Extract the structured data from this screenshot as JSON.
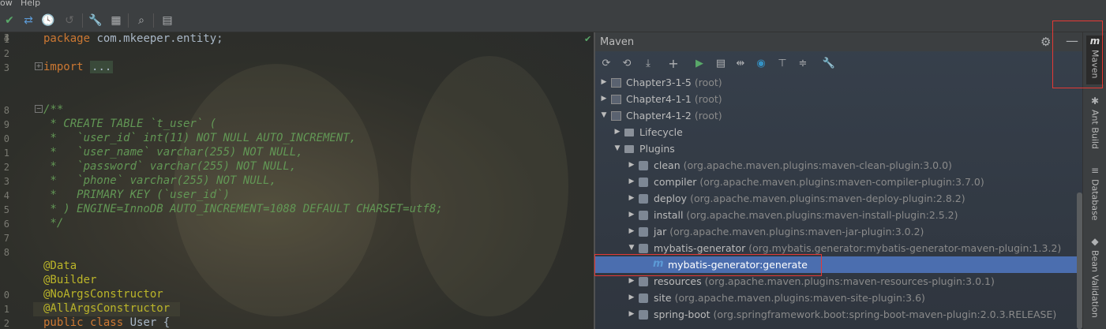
{
  "menu": {
    "items": [
      "ow",
      "Help"
    ]
  },
  "toolbar": {
    "icons": [
      "check-icon",
      "merge-icon",
      "history-icon",
      "undo-icon",
      "wrench-icon",
      "project-structure-icon",
      "search-icon",
      "terminal-icon"
    ]
  },
  "editor": {
    "line_numbers": [
      "1",
      "2",
      "3",
      "",
      "",
      "8",
      "9",
      "0",
      "1",
      "2",
      "3",
      "4",
      "5",
      "6",
      "7",
      "8",
      "",
      "",
      "0",
      "1",
      "2",
      "3",
      "4"
    ],
    "lines": [
      {
        "kind": "pkg",
        "kw": "package",
        "text": " com.mkeeper.entity;"
      },
      {
        "kind": "import",
        "kw": "import",
        "fold": "..."
      },
      {
        "kind": "comment",
        "text": "/**"
      },
      {
        "kind": "comment",
        "text": " * CREATE TABLE `t_user` ("
      },
      {
        "kind": "comment",
        "text": " *   `user_id` int(11) NOT NULL AUTO_INCREMENT,"
      },
      {
        "kind": "comment",
        "text": " *   `user_name` varchar(255) NOT NULL,"
      },
      {
        "kind": "comment",
        "text": " *   `password` varchar(255) NOT NULL,"
      },
      {
        "kind": "comment",
        "text": " *   `phone` varchar(255) NOT NULL,"
      },
      {
        "kind": "comment",
        "text": " *   PRIMARY KEY (`user_id`)"
      },
      {
        "kind": "comment",
        "text": " * ) ENGINE=InnoDB AUTO_INCREMENT=1088 DEFAULT CHARSET=utf8;"
      },
      {
        "kind": "comment",
        "text": " */"
      },
      {
        "kind": "anno",
        "text": "@Data"
      },
      {
        "kind": "anno",
        "text": "@Builder"
      },
      {
        "kind": "anno",
        "text": "@NoArgsConstructor"
      },
      {
        "kind": "anno",
        "text": "@AllArgsConstructor"
      },
      {
        "kind": "class",
        "kw": "public class",
        "text": " User {"
      }
    ]
  },
  "maven": {
    "title": "Maven",
    "tools": [
      "refresh-icon",
      "reimport-icon",
      "download-icon",
      "add-icon",
      "run-icon",
      "run-config-icon",
      "toggle-offline-icon",
      "skip-tests-icon",
      "show-deps-icon",
      "collapse-icon",
      "settings-wrench-icon"
    ],
    "tree": [
      {
        "depth": 0,
        "arrow": "▶",
        "icon": "module",
        "name": "Chapter3-1-5",
        "suffix": "(root)"
      },
      {
        "depth": 0,
        "arrow": "▶",
        "icon": "module",
        "name": "Chapter4-1-1",
        "suffix": "(root)"
      },
      {
        "depth": 0,
        "arrow": "▼",
        "icon": "module",
        "name": "Chapter4-1-2",
        "suffix": "(root)"
      },
      {
        "depth": 1,
        "arrow": "▶",
        "icon": "folder",
        "name": "Lifecycle",
        "suffix": ""
      },
      {
        "depth": 1,
        "arrow": "▼",
        "icon": "folder",
        "name": "Plugins",
        "suffix": ""
      },
      {
        "depth": 2,
        "arrow": "▶",
        "icon": "plugin",
        "name": "clean",
        "suffix": "(org.apache.maven.plugins:maven-clean-plugin:3.0.0)"
      },
      {
        "depth": 2,
        "arrow": "▶",
        "icon": "plugin",
        "name": "compiler",
        "suffix": "(org.apache.maven.plugins:maven-compiler-plugin:3.7.0)"
      },
      {
        "depth": 2,
        "arrow": "▶",
        "icon": "plugin",
        "name": "deploy",
        "suffix": "(org.apache.maven.plugins:maven-deploy-plugin:2.8.2)"
      },
      {
        "depth": 2,
        "arrow": "▶",
        "icon": "plugin",
        "name": "install",
        "suffix": "(org.apache.maven.plugins:maven-install-plugin:2.5.2)"
      },
      {
        "depth": 2,
        "arrow": "▶",
        "icon": "plugin",
        "name": "jar",
        "suffix": "(org.apache.maven.plugins:maven-jar-plugin:3.0.2)"
      },
      {
        "depth": 2,
        "arrow": "▼",
        "icon": "plugin",
        "name": "mybatis-generator",
        "suffix": "(org.mybatis.generator:mybatis-generator-maven-plugin:1.3.2)"
      },
      {
        "depth": 3,
        "arrow": "",
        "icon": "goal",
        "name": "mybatis-generator:generate",
        "suffix": "",
        "selected": true
      },
      {
        "depth": 2,
        "arrow": "▶",
        "icon": "plugin",
        "name": "resources",
        "suffix": "(org.apache.maven.plugins:maven-resources-plugin:3.0.1)"
      },
      {
        "depth": 2,
        "arrow": "▶",
        "icon": "plugin",
        "name": "site",
        "suffix": "(org.apache.maven.plugins:maven-site-plugin:3.6)"
      },
      {
        "depth": 2,
        "arrow": "▶",
        "icon": "plugin",
        "name": "spring-boot",
        "suffix": "(org.springframework.boot:spring-boot-maven-plugin:2.0.3.RELEASE)"
      }
    ]
  },
  "right_tabs": [
    {
      "label": "Maven",
      "icon": "m",
      "active": true
    },
    {
      "label": "Ant Build",
      "icon": "🐜",
      "active": false
    },
    {
      "label": "Database",
      "icon": "≡",
      "active": false
    },
    {
      "label": "Bean Validation",
      "icon": "◆",
      "active": false
    }
  ],
  "colors": {
    "selection": "#4b6eaf",
    "keyword": "#cc7832",
    "comment": "#629755",
    "annotation": "#bbb529",
    "highlight": "#e53935"
  }
}
